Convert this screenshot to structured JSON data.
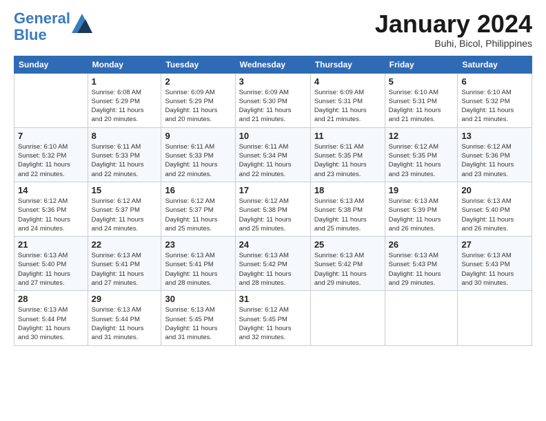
{
  "logo": {
    "line1": "General",
    "line2": "Blue"
  },
  "title": "January 2024",
  "subtitle": "Buhi, Bicol, Philippines",
  "days_of_week": [
    "Sunday",
    "Monday",
    "Tuesday",
    "Wednesday",
    "Thursday",
    "Friday",
    "Saturday"
  ],
  "weeks": [
    [
      {
        "day": "",
        "info": ""
      },
      {
        "day": "1",
        "info": "Sunrise: 6:08 AM\nSunset: 5:29 PM\nDaylight: 11 hours\nand 20 minutes."
      },
      {
        "day": "2",
        "info": "Sunrise: 6:09 AM\nSunset: 5:29 PM\nDaylight: 11 hours\nand 20 minutes."
      },
      {
        "day": "3",
        "info": "Sunrise: 6:09 AM\nSunset: 5:30 PM\nDaylight: 11 hours\nand 21 minutes."
      },
      {
        "day": "4",
        "info": "Sunrise: 6:09 AM\nSunset: 5:31 PM\nDaylight: 11 hours\nand 21 minutes."
      },
      {
        "day": "5",
        "info": "Sunrise: 6:10 AM\nSunset: 5:31 PM\nDaylight: 11 hours\nand 21 minutes."
      },
      {
        "day": "6",
        "info": "Sunrise: 6:10 AM\nSunset: 5:32 PM\nDaylight: 11 hours\nand 21 minutes."
      }
    ],
    [
      {
        "day": "7",
        "info": "Sunrise: 6:10 AM\nSunset: 5:32 PM\nDaylight: 11 hours\nand 22 minutes."
      },
      {
        "day": "8",
        "info": "Sunrise: 6:11 AM\nSunset: 5:33 PM\nDaylight: 11 hours\nand 22 minutes."
      },
      {
        "day": "9",
        "info": "Sunrise: 6:11 AM\nSunset: 5:33 PM\nDaylight: 11 hours\nand 22 minutes."
      },
      {
        "day": "10",
        "info": "Sunrise: 6:11 AM\nSunset: 5:34 PM\nDaylight: 11 hours\nand 22 minutes."
      },
      {
        "day": "11",
        "info": "Sunrise: 6:11 AM\nSunset: 5:35 PM\nDaylight: 11 hours\nand 23 minutes."
      },
      {
        "day": "12",
        "info": "Sunrise: 6:12 AM\nSunset: 5:35 PM\nDaylight: 11 hours\nand 23 minutes."
      },
      {
        "day": "13",
        "info": "Sunrise: 6:12 AM\nSunset: 5:36 PM\nDaylight: 11 hours\nand 23 minutes."
      }
    ],
    [
      {
        "day": "14",
        "info": "Sunrise: 6:12 AM\nSunset: 5:36 PM\nDaylight: 11 hours\nand 24 minutes."
      },
      {
        "day": "15",
        "info": "Sunrise: 6:12 AM\nSunset: 5:37 PM\nDaylight: 11 hours\nand 24 minutes."
      },
      {
        "day": "16",
        "info": "Sunrise: 6:12 AM\nSunset: 5:37 PM\nDaylight: 11 hours\nand 25 minutes."
      },
      {
        "day": "17",
        "info": "Sunrise: 6:12 AM\nSunset: 5:38 PM\nDaylight: 11 hours\nand 25 minutes."
      },
      {
        "day": "18",
        "info": "Sunrise: 6:13 AM\nSunset: 5:38 PM\nDaylight: 11 hours\nand 25 minutes."
      },
      {
        "day": "19",
        "info": "Sunrise: 6:13 AM\nSunset: 5:39 PM\nDaylight: 11 hours\nand 26 minutes."
      },
      {
        "day": "20",
        "info": "Sunrise: 6:13 AM\nSunset: 5:40 PM\nDaylight: 11 hours\nand 26 minutes."
      }
    ],
    [
      {
        "day": "21",
        "info": "Sunrise: 6:13 AM\nSunset: 5:40 PM\nDaylight: 11 hours\nand 27 minutes."
      },
      {
        "day": "22",
        "info": "Sunrise: 6:13 AM\nSunset: 5:41 PM\nDaylight: 11 hours\nand 27 minutes."
      },
      {
        "day": "23",
        "info": "Sunrise: 6:13 AM\nSunset: 5:41 PM\nDaylight: 11 hours\nand 28 minutes."
      },
      {
        "day": "24",
        "info": "Sunrise: 6:13 AM\nSunset: 5:42 PM\nDaylight: 11 hours\nand 28 minutes."
      },
      {
        "day": "25",
        "info": "Sunrise: 6:13 AM\nSunset: 5:42 PM\nDaylight: 11 hours\nand 29 minutes."
      },
      {
        "day": "26",
        "info": "Sunrise: 6:13 AM\nSunset: 5:43 PM\nDaylight: 11 hours\nand 29 minutes."
      },
      {
        "day": "27",
        "info": "Sunrise: 6:13 AM\nSunset: 5:43 PM\nDaylight: 11 hours\nand 30 minutes."
      }
    ],
    [
      {
        "day": "28",
        "info": "Sunrise: 6:13 AM\nSunset: 5:44 PM\nDaylight: 11 hours\nand 30 minutes."
      },
      {
        "day": "29",
        "info": "Sunrise: 6:13 AM\nSunset: 5:44 PM\nDaylight: 11 hours\nand 31 minutes."
      },
      {
        "day": "30",
        "info": "Sunrise: 6:13 AM\nSunset: 5:45 PM\nDaylight: 11 hours\nand 31 minutes."
      },
      {
        "day": "31",
        "info": "Sunrise: 6:12 AM\nSunset: 5:45 PM\nDaylight: 11 hours\nand 32 minutes."
      },
      {
        "day": "",
        "info": ""
      },
      {
        "day": "",
        "info": ""
      },
      {
        "day": "",
        "info": ""
      }
    ]
  ]
}
